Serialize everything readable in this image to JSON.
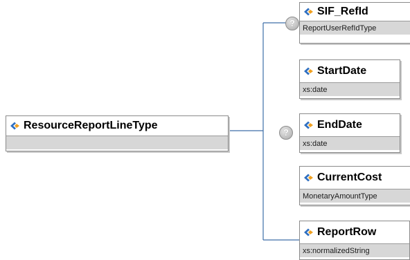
{
  "root": {
    "name": "ResourceReportLineType",
    "type": ""
  },
  "children": [
    {
      "name": "SIF_RefId",
      "type": "ReportUserRefIdType",
      "optional": true
    },
    {
      "name": "StartDate",
      "type": "xs:date",
      "optional": false
    },
    {
      "name": "EndDate",
      "type": "xs:date",
      "optional": true
    },
    {
      "name": "CurrentCost",
      "type": "MonetaryAmountType",
      "optional": false
    },
    {
      "name": "ReportRow",
      "type": "xs:normalizedString",
      "optional": false
    }
  ],
  "optional_marker": "?",
  "icons": {
    "element": "element-diamond-icon",
    "optional": "optional-question-icon"
  },
  "colors": {
    "connector": "#3d6ea8",
    "box_border": "#8a8a8a",
    "type_band": "#d7d7d7",
    "icon_blue": "#2f6fc0",
    "icon_orange": "#f0a020"
  }
}
